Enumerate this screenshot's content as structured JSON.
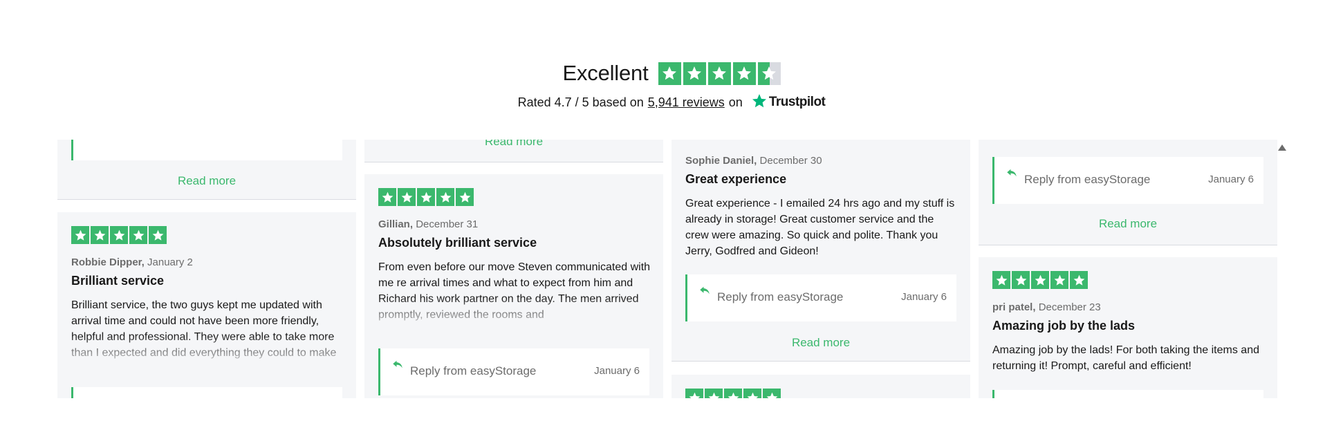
{
  "header": {
    "rating_word": "Excellent",
    "rated_prefix": "Rated 4.7 / 5 based on",
    "reviews_link": "5,941 reviews",
    "rated_suffix": "on",
    "brand": "Trustpilot"
  },
  "colors": {
    "star_green": "#3bb86d",
    "trustpilot_green": "#00b67a",
    "card_bg": "#f5f6f8"
  },
  "read_more": "Read more",
  "reply_label": "Reply from easyStorage",
  "columns": [
    {
      "cards": [
        {
          "author": "Robbie Dipper,",
          "date": "January 2",
          "title": "Brilliant service",
          "body": "Brilliant service, the two guys kept me updated with arrival time and could not have been more friendly, helpful and professional. They were able to take more than I expected and did everything they could to make"
        }
      ]
    },
    {
      "cards": [
        {
          "author": "Gillian,",
          "date": "December 31",
          "title": "Absolutely brilliant service",
          "body": "From even before our move Steven communicated with me re arrival times and what to expect from him and Richard his work partner on the day. The men arrived promptly, reviewed the rooms and",
          "reply_date": "January 6"
        }
      ]
    },
    {
      "cards": [
        {
          "author": "Sophie Daniel,",
          "date": "December 30",
          "title": "Great experience",
          "body": "Great experience - I emailed 24 hrs ago and my stuff is already in storage! Great customer service and the crew were amazing. So quick and polite. Thank you Jerry, Godfred and Gideon!",
          "reply_date": "January 6"
        }
      ]
    },
    {
      "top_reply_date": "January 6",
      "cards": [
        {
          "author": "pri patel,",
          "date": "December 23",
          "title": "Amazing job by the lads",
          "body": "Amazing job by the lads! For both taking the items and returning it! Prompt, careful and efficient!"
        }
      ]
    }
  ]
}
